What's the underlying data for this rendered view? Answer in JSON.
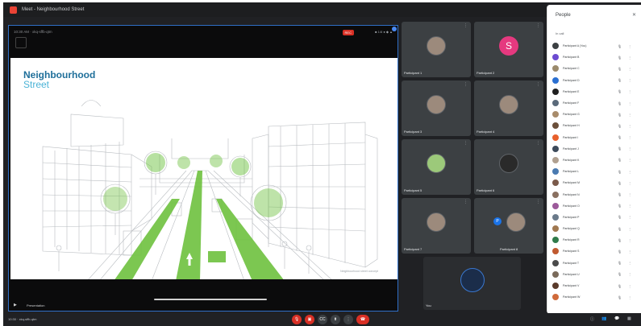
{
  "window": {
    "title": "Meet - Neighbourhood Street"
  },
  "presentation": {
    "meeting_code": "10:30 AM · xkq-sffb-qtm",
    "rec_badge": "REC",
    "status": "■ 1/8  ● ◆ ▲",
    "bottom_label": "Presentation",
    "slide": {
      "title": "Neighbourhood",
      "subtitle": "Street",
      "credit": "Neighbourhood street concept"
    }
  },
  "tiles": [
    {
      "name": "Participant 1",
      "more": "⋮",
      "type": "photo"
    },
    {
      "name": "Participant 2",
      "more": "⋮",
      "type": "letter",
      "letter": "S"
    },
    {
      "name": "Participant 3",
      "more": "⋮",
      "type": "photo"
    },
    {
      "name": "Participant 4",
      "more": "⋮",
      "type": "photo"
    },
    {
      "name": "Participant 5",
      "more": "⋮",
      "type": "photo-green"
    },
    {
      "name": "Participant 6",
      "more": "⋮",
      "type": "photo-dark"
    },
    {
      "name": "Participant 7",
      "more": "⋮",
      "type": "photo"
    },
    {
      "name": "Participant 8",
      "more": "⋮",
      "type": "small-letter",
      "letter": "P"
    },
    {
      "name": "You",
      "more": "",
      "type": "photo-dark"
    }
  ],
  "people_panel": {
    "title": "People",
    "close": "✕",
    "section": "In call",
    "people": [
      {
        "name": "Participant A (You)",
        "mic": "🎙",
        "more": "⋮"
      },
      {
        "name": "Participant B",
        "mic": "🎙",
        "more": "⋮"
      },
      {
        "name": "Participant C",
        "mic": "🎙",
        "more": "⋮"
      },
      {
        "name": "Participant D",
        "mic": "🎙",
        "more": "⋮"
      },
      {
        "name": "Participant E",
        "mic": "🎙",
        "more": "⋮"
      },
      {
        "name": "Participant F",
        "mic": "🎙",
        "more": "⋮"
      },
      {
        "name": "Participant G",
        "mic": "🎙",
        "more": "⋮"
      },
      {
        "name": "Participant H",
        "mic": "🎙",
        "more": "⋮"
      },
      {
        "name": "Participant I",
        "mic": "🎙",
        "more": "⋮"
      },
      {
        "name": "Participant J",
        "mic": "🎙",
        "more": "⋮"
      },
      {
        "name": "Participant K",
        "mic": "🎙",
        "more": "⋮"
      },
      {
        "name": "Participant L",
        "mic": "🎙",
        "more": "⋮"
      },
      {
        "name": "Participant M",
        "mic": "🎙",
        "more": "⋮"
      },
      {
        "name": "Participant N",
        "mic": "🎙",
        "more": "⋮"
      },
      {
        "name": "Participant O",
        "mic": "🎙",
        "more": "⋮"
      },
      {
        "name": "Participant P",
        "mic": "🎙",
        "more": "⋮"
      },
      {
        "name": "Participant Q",
        "mic": "🎙",
        "more": "⋮"
      },
      {
        "name": "Participant R",
        "mic": "🎙",
        "more": "⋮"
      },
      {
        "name": "Participant S",
        "mic": "🎙",
        "more": "⋮"
      },
      {
        "name": "Participant T",
        "mic": "🎙",
        "more": "⋮"
      },
      {
        "name": "Participant U",
        "mic": "🎙",
        "more": "⋮"
      },
      {
        "name": "Participant V",
        "mic": "🎙",
        "more": "⋮"
      },
      {
        "name": "Participant W",
        "mic": "🎙",
        "more": "⋮"
      }
    ]
  },
  "bottombar": {
    "meeting_info": "10:30 · xkq-sffb-qtm",
    "controls": {
      "mic": "🎙",
      "camera": "▣",
      "captions": "CC",
      "present": "⬆",
      "more": "⋮",
      "leave": "☎"
    },
    "right": {
      "info": "ⓘ",
      "people": "👥",
      "chat": "💬",
      "activities": "▦"
    }
  },
  "colors": {
    "accent": "#2f6fc7",
    "leave_red": "#d93025",
    "slide_title": "#1f6f9a",
    "slide_green": "#6ec13f"
  }
}
